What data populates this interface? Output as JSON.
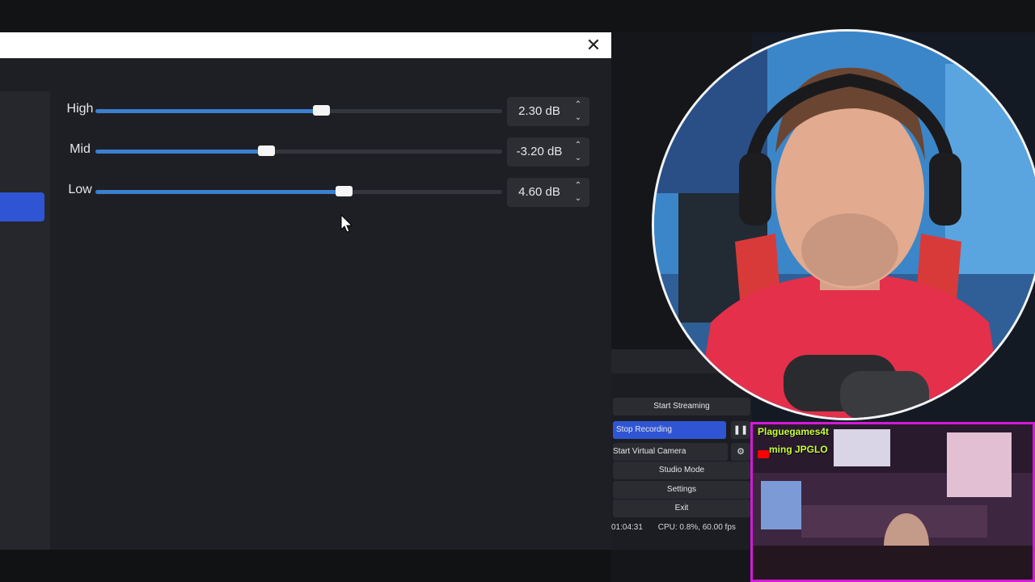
{
  "dialog": {
    "close_glyph": "✕",
    "eq": [
      {
        "label": "High",
        "value": "2.30 dB",
        "level": 0.555
      },
      {
        "label": "Mid",
        "value": "-3.20 dB",
        "level": 0.42
      },
      {
        "label": "Low",
        "value": "4.60 dB",
        "level": 0.61
      }
    ],
    "spin_up": "⌃",
    "spin_down": "⌄"
  },
  "controls": {
    "start_streaming": "Start Streaming",
    "stop_recording": "Stop Recording",
    "pause_glyph": "❚❚",
    "start_virtual_camera": "Start Virtual Camera",
    "settings_glyph": "⚙",
    "studio_mode": "Studio Mode",
    "settings": "Settings",
    "exit": "Exit",
    "status_time": "01:04:31",
    "status_cpu": "CPU: 0.8%, 60.00 fps"
  },
  "thumbnail": {
    "title": "Plaguegames4t",
    "subtitle": "ming JPGLO"
  },
  "colors": {
    "accent": "#2f55d4",
    "slider_fill": "#3a7fd0",
    "thumbnail_border": "#d21bd6"
  }
}
